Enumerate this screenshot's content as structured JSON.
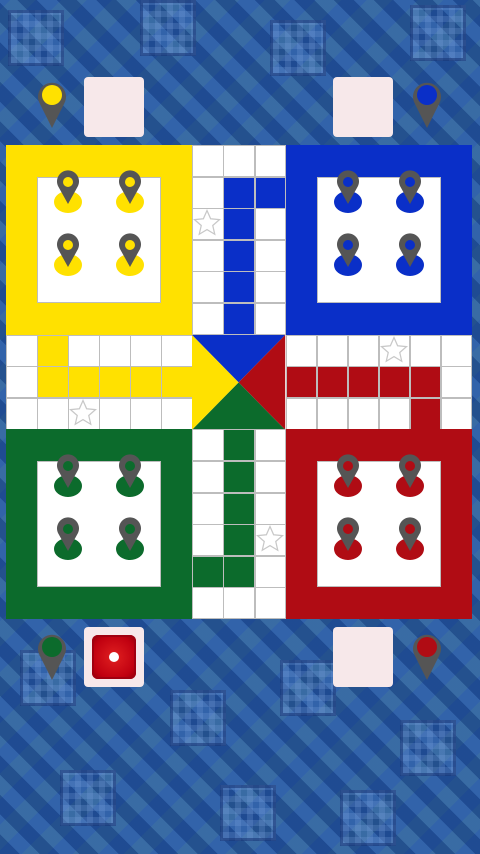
{
  "game": "ludo",
  "colors": {
    "yellow": "#ffe100",
    "blue": "#0a2fc8",
    "green": "#0c6b2c",
    "red": "#b00c14",
    "pin_gray": "#555555",
    "board_line": "#bdbdbd",
    "slot_bg": "#f7e8ea"
  },
  "players": [
    {
      "color": "yellow",
      "position": "top-left",
      "tokens_at_home": 4,
      "active": false
    },
    {
      "color": "blue",
      "position": "top-right",
      "tokens_at_home": 4,
      "active": false
    },
    {
      "color": "green",
      "position": "bottom-left",
      "tokens_at_home": 4,
      "active": true
    },
    {
      "color": "red",
      "position": "bottom-right",
      "tokens_at_home": 4,
      "active": false
    }
  ],
  "dice": {
    "value": 1,
    "owner": "green"
  },
  "safe_star_icon": "star-outline-icon"
}
